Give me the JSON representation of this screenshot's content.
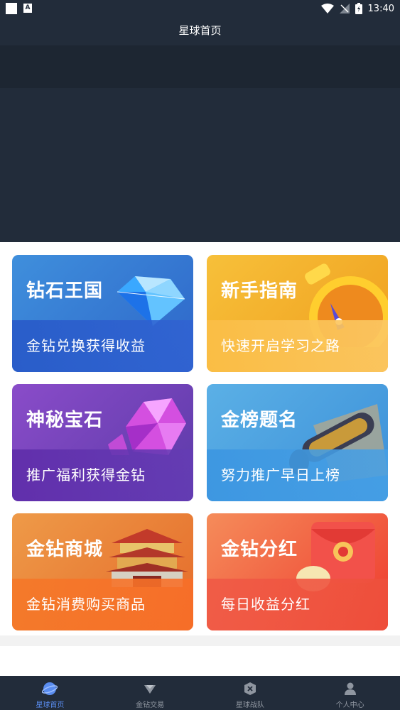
{
  "status_bar": {
    "time": "13:40",
    "app_badge": "A"
  },
  "header": {
    "title": "星球首页"
  },
  "cards": [
    {
      "title": "钻石王国",
      "subtitle": "金钻兑换获得收益",
      "icon": "diamond-icon"
    },
    {
      "title": "新手指南",
      "subtitle": "快速开启学习之路",
      "icon": "stopwatch-icon"
    },
    {
      "title": "神秘宝石",
      "subtitle": "推广福利获得金钻",
      "icon": "gem-icon"
    },
    {
      "title": "金榜题名",
      "subtitle": "努力推广早日上榜",
      "icon": "scroll-icon"
    },
    {
      "title": "金钻商城",
      "subtitle": "金钻消费购买商品",
      "icon": "palace-icon"
    },
    {
      "title": "金钻分红",
      "subtitle": "每日收益分红",
      "icon": "red-envelope-icon"
    }
  ],
  "tabbar": [
    {
      "label": "星球首页",
      "icon": "planet-icon",
      "active": true
    },
    {
      "label": "金钻交易",
      "icon": "diamond-trade-icon",
      "active": false
    },
    {
      "label": "星球战队",
      "icon": "team-icon",
      "active": false
    },
    {
      "label": "个人中心",
      "icon": "user-icon",
      "active": false
    }
  ],
  "colors": {
    "dark": "#222c3a",
    "active_tab": "#5a8df0",
    "inactive_tab": "#8f96a0"
  }
}
